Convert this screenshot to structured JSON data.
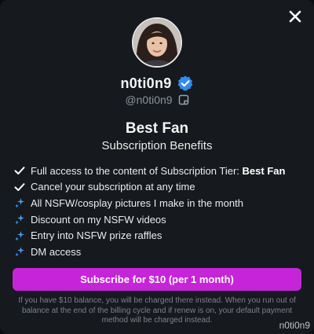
{
  "creator": {
    "display_name": "n0ti0n9",
    "handle": "@n0ti0n9",
    "verified": true
  },
  "tier": {
    "title": "Best Fan",
    "subtitle": "Subscription Benefits"
  },
  "benefits": [
    {
      "icon": "check-icon",
      "text": "Full access to the content of Subscription Tier: ",
      "bold": "Best Fan"
    },
    {
      "icon": "check-icon",
      "text": "Cancel your subscription at any time",
      "bold": ""
    },
    {
      "icon": "sparkle-icon",
      "text": "All NSFW/cosplay pictures I make in the month",
      "bold": ""
    },
    {
      "icon": "sparkle-icon",
      "text": "Discount on my NSFW videos",
      "bold": ""
    },
    {
      "icon": "sparkle-icon",
      "text": "Entry into NSFW prize raffles",
      "bold": ""
    },
    {
      "icon": "sparkle-icon",
      "text": "DM access",
      "bold": ""
    }
  ],
  "subscribe_button": {
    "label": "Subscribe for $10 (per 1 month)"
  },
  "fine_print": "If you have $10 balance, you will be charged there instead. When you run out of balance at the end of the billing cycle and if renew is on, your default payment method will be charged instead.",
  "watermark": "n0ti0n9",
  "colors": {
    "modal_bg": "#16191d",
    "accent_button": "#c624d9",
    "verified_blue": "#2f8cf0",
    "sparkle_blue": "#3fa2ff",
    "muted_text": "#7d838a"
  }
}
